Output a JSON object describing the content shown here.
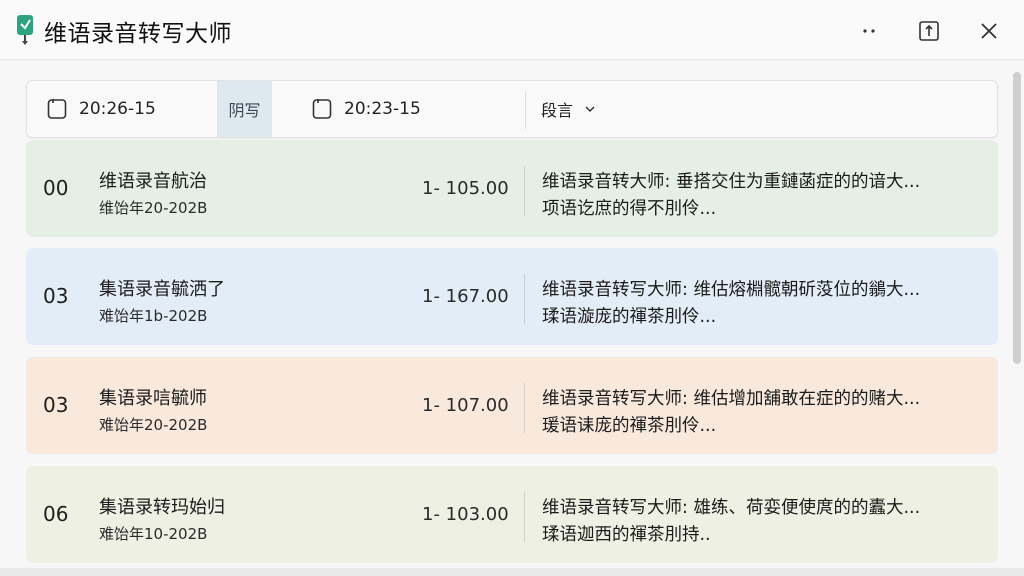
{
  "window": {
    "title": "维语录音转写大师",
    "accent": "#2ea37f"
  },
  "toolbar": {
    "date_start": "20:26-15",
    "mode_label": "阴写",
    "date_end": "20:23-15",
    "language_label": "段言"
  },
  "items": [
    {
      "num": "00",
      "title": "维语录音航治",
      "subtitle": "维饴年20-202B",
      "range": "1- 105.00",
      "desc_line1": "维语录音转大师: 垂搭交住为重鏈菡症的的谙大...",
      "desc_line2": "项语讫庶的得不刖伶...",
      "bg": "#e5efe5"
    },
    {
      "num": "03",
      "title": "集语录音毓洒了",
      "subtitle": "难饴年1b-202B",
      "range": "1- 167.00",
      "desc_line1": "维语录音转写大师: 维估熔棩髋朝斫莈位的鶲大...",
      "desc_line2": "瑈语漩庞的禈茶刖伶...",
      "bg": "#e3edf7"
    },
    {
      "num": "03",
      "title": "集语录唁毓师",
      "subtitle": "难饴年20-202B",
      "range": "1- 107.00",
      "desc_line1": "维语录音转写大师: 维估增加舖敢在症的的赌大...",
      "desc_line2": "瑗语诔庞的禈茶刖伶...",
      "bg": "#f8e9dc"
    },
    {
      "num": "06",
      "title": "集语录转玛始归",
      "subtitle": "难饴年10-202B",
      "range": "1- 103.00",
      "desc_line1": "维语录音转写大师: 雄练、荷娈便使庹的的蠹大...",
      "desc_line2": "瑈语迦西的禈茶刖持..",
      "bg": "#edf0e3"
    }
  ]
}
